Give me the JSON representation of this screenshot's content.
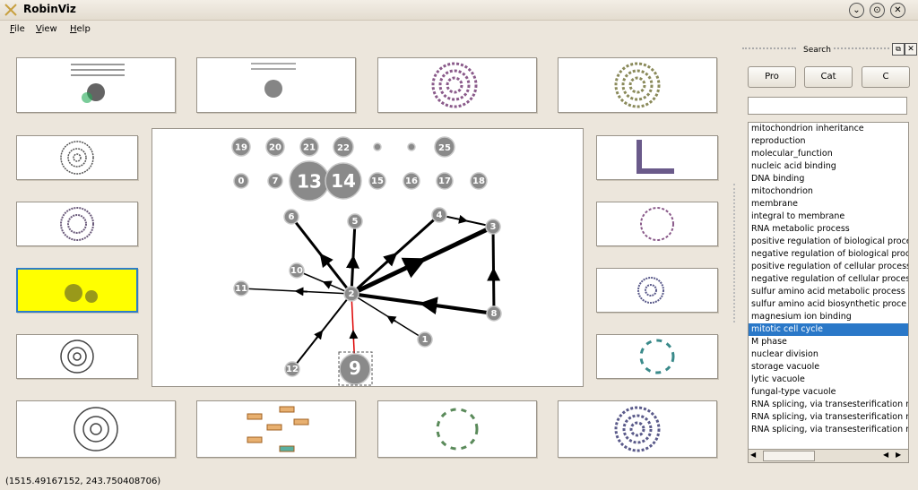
{
  "window": {
    "title": "RobinViz"
  },
  "menu": [
    {
      "key": "F",
      "rest": "ile"
    },
    {
      "key": "V",
      "rest": "iew"
    },
    {
      "key": "H",
      "rest": "elp"
    }
  ],
  "main_graph": {
    "nodes": [
      {
        "id": "19"
      },
      {
        "id": "20"
      },
      {
        "id": "21"
      },
      {
        "id": "22"
      },
      {
        "id": "23"
      },
      {
        "id": "24"
      },
      {
        "id": "25"
      },
      {
        "id": "0"
      },
      {
        "id": "7"
      },
      {
        "id": "13"
      },
      {
        "id": "14"
      },
      {
        "id": "15"
      },
      {
        "id": "16"
      },
      {
        "id": "17"
      },
      {
        "id": "18"
      },
      {
        "id": "6"
      },
      {
        "id": "5"
      },
      {
        "id": "4"
      },
      {
        "id": "3"
      },
      {
        "id": "10"
      },
      {
        "id": "11"
      },
      {
        "id": "2"
      },
      {
        "id": "8"
      },
      {
        "id": "1"
      },
      {
        "id": "12"
      },
      {
        "id": "9"
      }
    ]
  },
  "sidebar": {
    "title": "Search",
    "buttons": [
      "Pro",
      "Cat",
      "C"
    ],
    "search_value": "",
    "list": [
      "mitochondrion inheritance",
      "reproduction",
      "molecular_function",
      "nucleic acid binding",
      "DNA binding",
      "mitochondrion",
      "membrane",
      "integral to membrane",
      "RNA metabolic process",
      "positive regulation of biological proce",
      "negative regulation of biological proce",
      "positive regulation of cellular process",
      "negative regulation of cellular process",
      "sulfur amino acid metabolic process",
      "sulfur amino acid biosynthetic proce",
      "magnesium ion binding",
      "mitotic cell cycle",
      "M phase",
      "nuclear division",
      "storage vacuole",
      "lytic vacuole",
      "fungal-type vacuole",
      "RNA splicing, via transesterification r",
      "RNA splicing, via transesterification r",
      "RNA splicing, via transesterification r"
    ],
    "selected_item": "mitotic cell cycle"
  },
  "status": {
    "coordinates": "(1515.49167152, 243.750408706)"
  },
  "colors": {
    "selection": "#2a78c8",
    "highlight_thumb": "#ffff00",
    "window_bg": "#ece6dc"
  }
}
